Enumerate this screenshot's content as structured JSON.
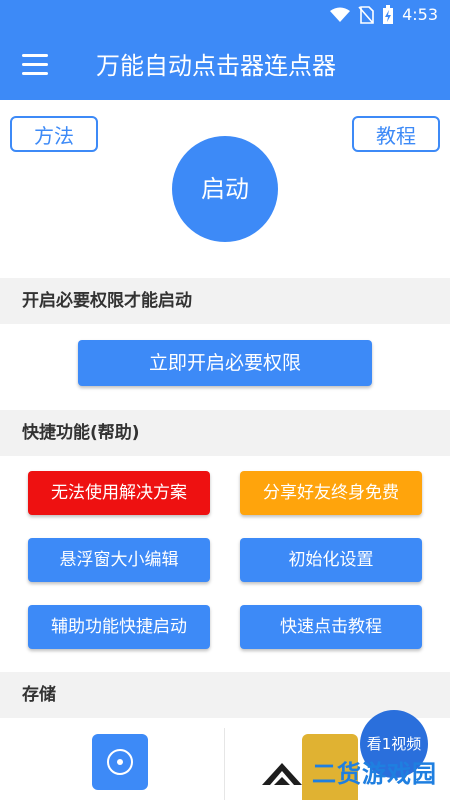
{
  "status_bar": {
    "time": "4:53"
  },
  "app_bar": {
    "title": "万能自动点击器连点器"
  },
  "top": {
    "method_label": "方法",
    "tutorial_label": "教程",
    "start_label": "启动"
  },
  "sections": {
    "permission_header": "开启必要权限才能启动",
    "quick_header": "快捷功能(帮助)",
    "storage_header": "存储"
  },
  "permission": {
    "button_label": "立即开启必要权限"
  },
  "quick_functions": [
    {
      "label": "无法使用解决方案",
      "color": "#ee1111"
    },
    {
      "label": "分享好友终身免费",
      "color": "#ffa40c"
    },
    {
      "label": "悬浮窗大小编辑",
      "color": "#3d8af7"
    },
    {
      "label": "初始化设置",
      "color": "#3d8af7"
    },
    {
      "label": "辅助功能快捷启动",
      "color": "#3d8af7"
    },
    {
      "label": "快速点击教程",
      "color": "#3d8af7"
    }
  ],
  "floating": {
    "video_label": "看1视频"
  },
  "watermark": {
    "text": "二货游戏园"
  },
  "colors": {
    "primary": "#3d8af7",
    "red": "#ee1111",
    "orange": "#ffa40c",
    "section_bg": "#f2f2f2"
  }
}
